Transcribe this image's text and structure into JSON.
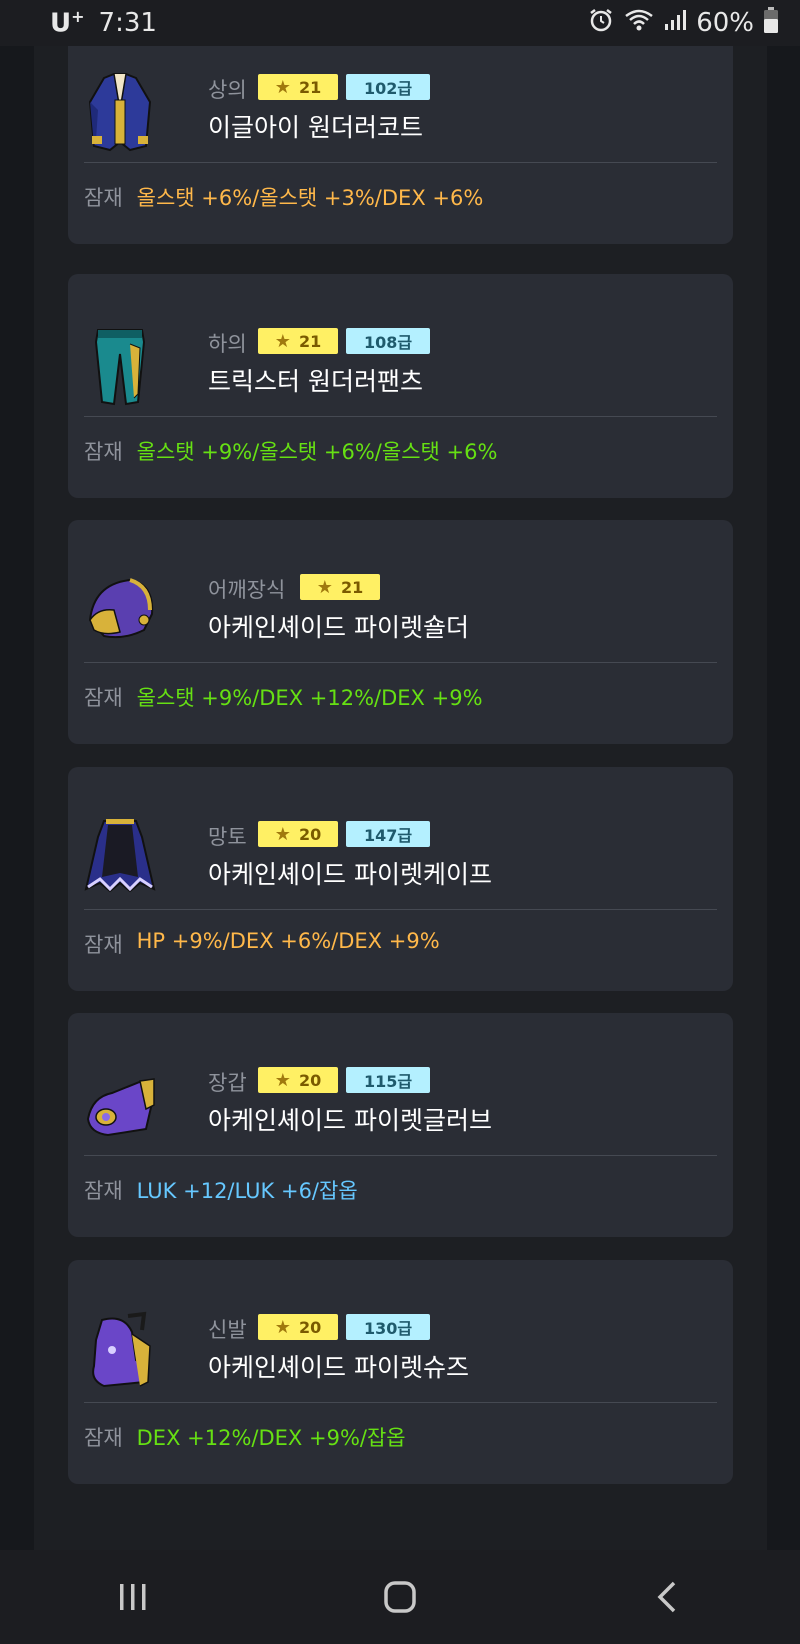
{
  "status_bar": {
    "carrier": "U",
    "carrier_plus": "+",
    "time": "7:31",
    "battery": "60%"
  },
  "potential_label": "잠재",
  "items": [
    {
      "slot": "상의",
      "stars": "21",
      "grade": "102급",
      "name": "이글아이 원더러코트",
      "potential": "올스탯 +6%/올스탯 +3%/DEX +6%",
      "potential_color": "#ffb84a"
    },
    {
      "slot": "하의",
      "stars": "21",
      "grade": "108급",
      "name": "트릭스터 원더러팬츠",
      "potential": "올스탯 +9%/올스탯 +6%/올스탯 +6%",
      "potential_color": "#66e013"
    },
    {
      "slot": "어깨장식",
      "stars": "21",
      "grade": "",
      "name": "아케인셰이드 파이렛숄더",
      "potential": "올스탯 +9%/DEX +12%/DEX +9%",
      "potential_color": "#66e013"
    },
    {
      "slot": "망토",
      "stars": "20",
      "grade": "147급",
      "name": "아케인셰이드 파이렛케이프",
      "potential": "HP +9%/DEX +6%/DEX +9%",
      "potential_color": "#ffb84a"
    },
    {
      "slot": "장갑",
      "stars": "20",
      "grade": "115급",
      "name": "아케인셰이드 파이렛글러브",
      "potential": "LUK +12/LUK +6/잡옵",
      "potential_color": "#66c8ff"
    },
    {
      "slot": "신발",
      "stars": "20",
      "grade": "130급",
      "name": "아케인셰이드 파이렛슈즈",
      "potential": "DEX +12%/DEX +9%/잡옵",
      "potential_color": "#66e013"
    }
  ],
  "icons": {
    "status": [
      "alarm-icon",
      "wifi-icon",
      "signal-icon",
      "battery-icon"
    ],
    "nav": [
      "recent-apps-icon",
      "home-icon",
      "back-icon"
    ],
    "items": [
      "coat-icon",
      "pants-icon",
      "shoulder-icon",
      "cape-icon",
      "glove-icon",
      "shoes-icon"
    ]
  }
}
